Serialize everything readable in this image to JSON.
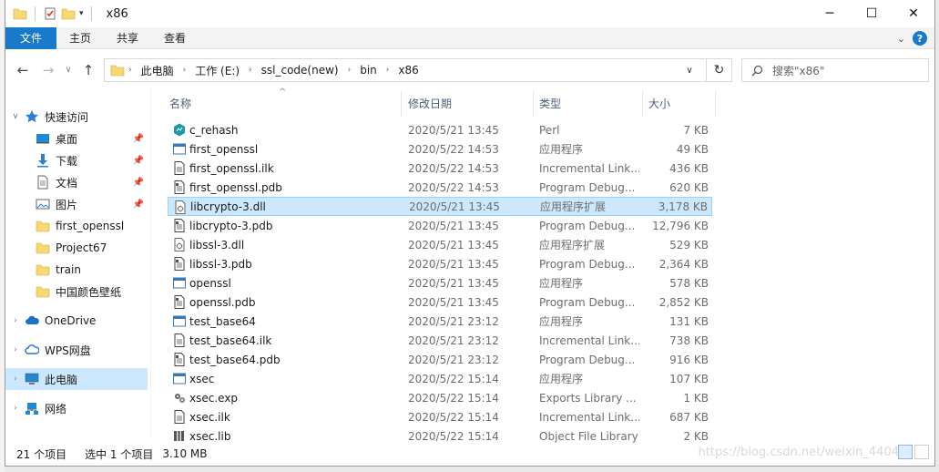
{
  "window": {
    "title": "x86",
    "minimize": "─",
    "maximize": "☐",
    "close": "✕"
  },
  "ribbon": {
    "tabs": [
      "文件",
      "主页",
      "共享",
      "查看"
    ],
    "help": "?",
    "expand": "⌄"
  },
  "address": {
    "crumbs": [
      "此电脑",
      "工作 (E:)",
      "ssl_code(new)",
      "bin",
      "x86"
    ],
    "search_placeholder": "搜索\"x86\""
  },
  "nav": {
    "items": [
      {
        "label": "快速访问",
        "icon": "star-icon",
        "pinned": false
      },
      {
        "label": "桌面",
        "icon": "desktop-icon",
        "pinned": true
      },
      {
        "label": "下载",
        "icon": "download-icon",
        "pinned": true
      },
      {
        "label": "文档",
        "icon": "document-icon",
        "pinned": true
      },
      {
        "label": "图片",
        "icon": "picture-icon",
        "pinned": true
      },
      {
        "label": "first_openssl",
        "icon": "folder-icon",
        "pinned": false
      },
      {
        "label": "Project67",
        "icon": "folder-icon",
        "pinned": false
      },
      {
        "label": "train",
        "icon": "folder-icon",
        "pinned": false
      },
      {
        "label": "中国颜色壁纸",
        "icon": "folder-icon",
        "pinned": false
      },
      {
        "label": "OneDrive",
        "icon": "cloud-icon",
        "pinned": false
      },
      {
        "label": "WPS网盘",
        "icon": "wps-cloud-icon",
        "pinned": false
      },
      {
        "label": "此电脑",
        "icon": "pc-icon",
        "pinned": false
      },
      {
        "label": "网络",
        "icon": "network-icon",
        "pinned": false
      }
    ]
  },
  "columns": {
    "name": "名称",
    "date": "修改日期",
    "type": "类型",
    "size": "大小"
  },
  "files": [
    {
      "name": "c_rehash",
      "date": "2020/5/21 13:45",
      "type": "Perl",
      "size": "7 KB",
      "icon": "perl-icon"
    },
    {
      "name": "first_openssl",
      "date": "2020/5/22 14:53",
      "type": "应用程序",
      "size": "49 KB",
      "icon": "exe-icon"
    },
    {
      "name": "first_openssl.ilk",
      "date": "2020/5/22 14:53",
      "type": "Incremental Link...",
      "size": "436 KB",
      "icon": "ilk-icon"
    },
    {
      "name": "first_openssl.pdb",
      "date": "2020/5/22 14:53",
      "type": "Program Debug...",
      "size": "620 KB",
      "icon": "pdb-icon"
    },
    {
      "name": "libcrypto-3.dll",
      "date": "2020/5/21 13:45",
      "type": "应用程序扩展",
      "size": "3,178 KB",
      "icon": "dll-icon"
    },
    {
      "name": "libcrypto-3.pdb",
      "date": "2020/5/21 13:45",
      "type": "Program Debug...",
      "size": "12,796 KB",
      "icon": "pdb-icon"
    },
    {
      "name": "libssl-3.dll",
      "date": "2020/5/21 13:45",
      "type": "应用程序扩展",
      "size": "529 KB",
      "icon": "dll-icon"
    },
    {
      "name": "libssl-3.pdb",
      "date": "2020/5/21 13:45",
      "type": "Program Debug...",
      "size": "2,364 KB",
      "icon": "pdb-icon"
    },
    {
      "name": "openssl",
      "date": "2020/5/21 13:45",
      "type": "应用程序",
      "size": "578 KB",
      "icon": "exe-icon"
    },
    {
      "name": "openssl.pdb",
      "date": "2020/5/21 13:45",
      "type": "Program Debug...",
      "size": "2,852 KB",
      "icon": "pdb-icon"
    },
    {
      "name": "test_base64",
      "date": "2020/5/21 23:12",
      "type": "应用程序",
      "size": "131 KB",
      "icon": "exe-icon"
    },
    {
      "name": "test_base64.ilk",
      "date": "2020/5/21 23:12",
      "type": "Incremental Link...",
      "size": "738 KB",
      "icon": "ilk-icon"
    },
    {
      "name": "test_base64.pdb",
      "date": "2020/5/21 23:12",
      "type": "Program Debug...",
      "size": "916 KB",
      "icon": "pdb-icon"
    },
    {
      "name": "xsec",
      "date": "2020/5/22 15:14",
      "type": "应用程序",
      "size": "107 KB",
      "icon": "exe-icon"
    },
    {
      "name": "xsec.exp",
      "date": "2020/5/22 15:14",
      "type": "Exports Library ...",
      "size": "1 KB",
      "icon": "exp-icon"
    },
    {
      "name": "xsec.ilk",
      "date": "2020/5/22 15:14",
      "type": "Incremental Link...",
      "size": "687 KB",
      "icon": "ilk-icon"
    },
    {
      "name": "xsec.lib",
      "date": "2020/5/22 15:14",
      "type": "Object File Library",
      "size": "2 KB",
      "icon": "lib-icon"
    }
  ],
  "status": {
    "count": "21 个项目",
    "selected": "选中 1 个项目",
    "selected_size": "3.10 MB"
  },
  "watermark": "https://blog.csdn.net/weixin_4404",
  "colors": {
    "accent": "#1979ca",
    "selection": "#cce8ff",
    "folder": "#f8d775"
  }
}
